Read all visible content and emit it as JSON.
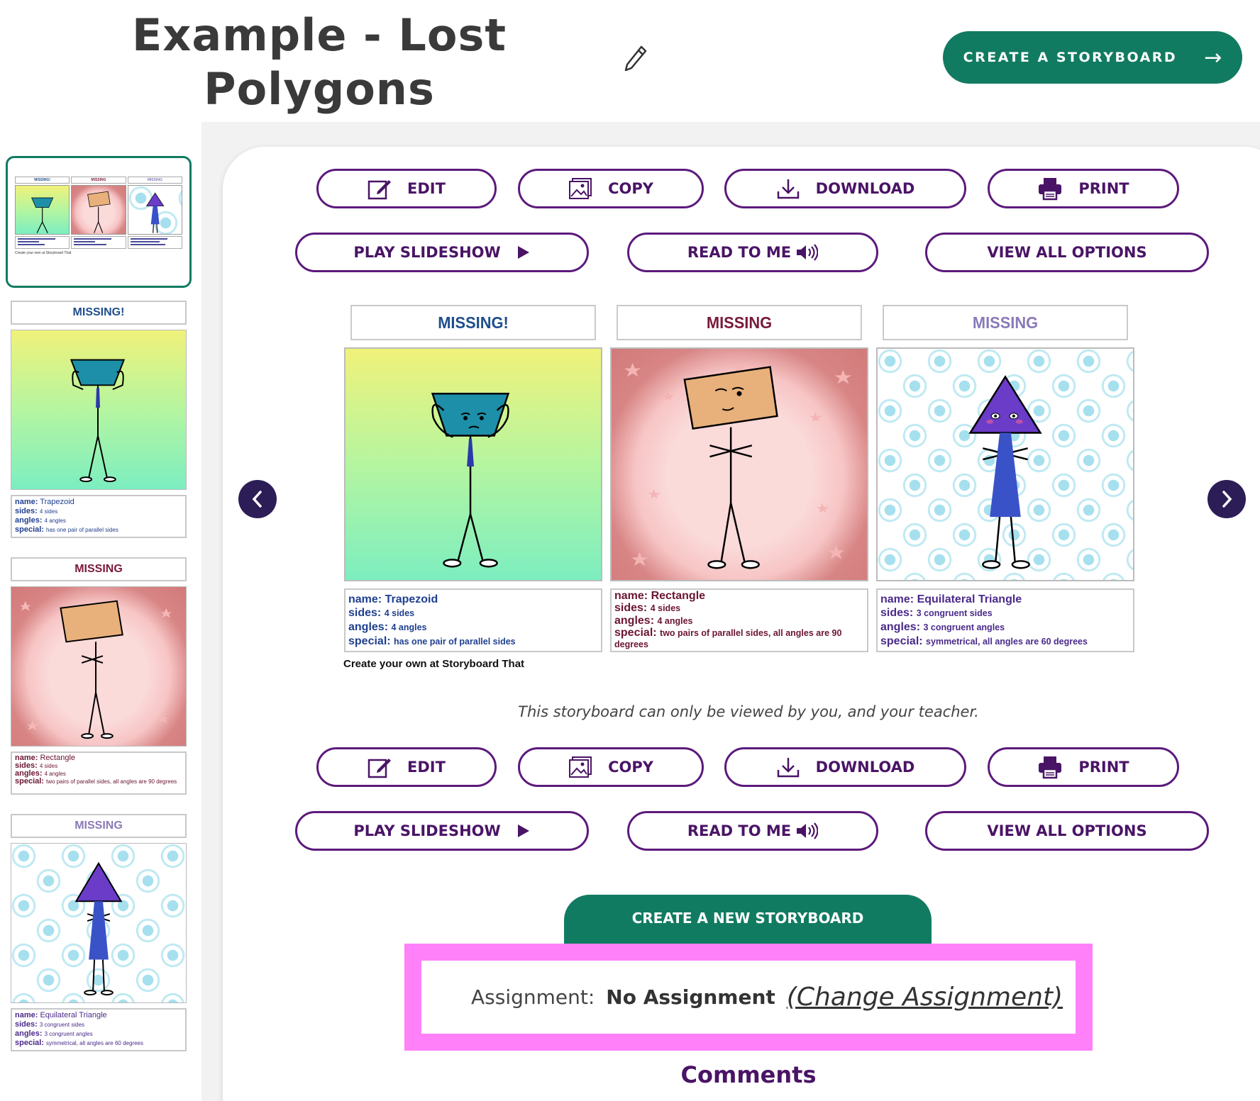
{
  "header": {
    "title_line1": "Example - Lost",
    "title_line2": "Polygons",
    "create_button": "CREATE A STORYBOARD",
    "create_arrow": "→"
  },
  "actions": {
    "edit": "EDIT",
    "copy": "COPY",
    "download": "DOWNLOAD",
    "print": "PRINT",
    "slideshow": "PLAY SLIDESHOW",
    "read_to_me": "READ TO ME",
    "view_all": "VIEW ALL OPTIONS"
  },
  "cells": [
    {
      "title": "MISSING!",
      "title_color": "#1f4e8c",
      "name_label": "name:",
      "name": "Trapezoid",
      "sides_label": "sides:",
      "sides": "4 sides",
      "angles_label": "angles:",
      "angles": "4 angles",
      "special_label": "special:",
      "special": "has one pair of parallel sides",
      "text_color": "#1f3f8f"
    },
    {
      "title": "MISSING",
      "title_color": "#7a1a3a",
      "name_label": "name:",
      "name": "Rectangle",
      "sides_label": "sides:",
      "sides": "4 sides",
      "angles_label": "angles:",
      "angles": "4 angles",
      "special_label": "special:",
      "special": "two pairs of parallel sides, all angles are 90 degrees",
      "text_color": "#6b1530"
    },
    {
      "title": "MISSING",
      "title_color": "#8a7ab8",
      "name_label": "name:",
      "name": "Equilateral Triangle",
      "sides_label": "sides:",
      "sides": "3 congruent sides",
      "angles_label": "angles:",
      "angles": "3 congruent angles",
      "special_label": "special:",
      "special": "symmetrical, all angles are 60 degrees",
      "text_color": "#4a2a8a"
    }
  ],
  "credit": "Create your own at Storyboard That",
  "privacy_note": "This storyboard can only be viewed by you, and your teacher.",
  "new_storyboard_button": "CREATE A NEW STORYBOARD",
  "assignment": {
    "label": "Assignment:",
    "value": "No Assignment",
    "change_link": "(Change Assignment)"
  },
  "comments_heading": "Comments",
  "colors": {
    "brand_green": "#117b61",
    "purple": "#4a1466",
    "assignment_highlight": "#ff80f8",
    "nav_arrow": "#2c1d57"
  },
  "icons": [
    "pencil-icon",
    "arrow-right-icon",
    "edit-icon",
    "copy-icon",
    "download-icon",
    "print-icon",
    "play-icon",
    "speaker-icon",
    "chevron-left-icon",
    "chevron-right-icon"
  ]
}
